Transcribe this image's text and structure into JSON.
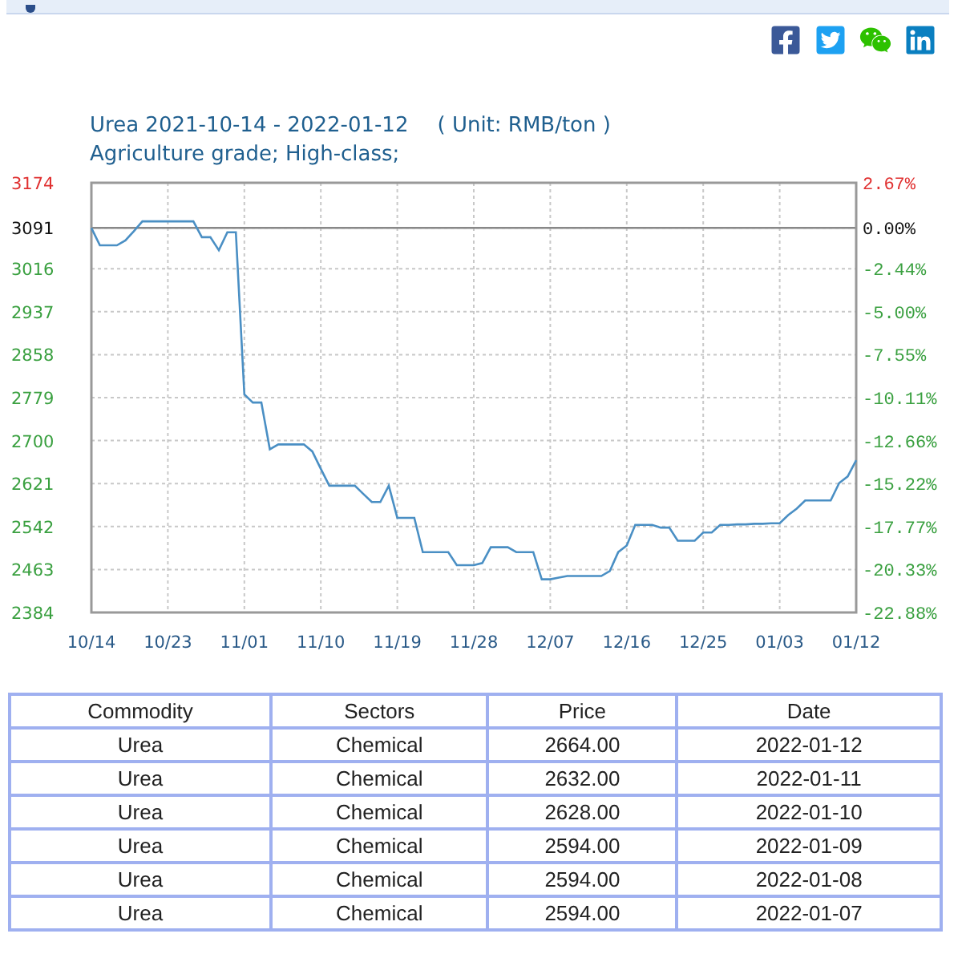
{
  "chart": {
    "title": "Urea 2021-10-14 - 2022-01-12",
    "unit": "( Unit: RMB/ton )",
    "subtitle": "Agriculture grade; High-class;",
    "right_axis_labels": [
      "2.67%",
      "0.00%",
      "-2.44%",
      "-5.00%",
      "-7.55%",
      "-10.11%",
      "-12.66%",
      "-15.22%",
      "-17.77%",
      "-20.33%",
      "-22.88%"
    ],
    "chart_data": {
      "type": "line",
      "categories": [
        "10/14",
        null,
        null,
        null,
        null,
        null,
        null,
        null,
        null,
        "10/23",
        null,
        null,
        null,
        null,
        null,
        null,
        null,
        null,
        "11/01",
        null,
        null,
        null,
        null,
        null,
        null,
        null,
        null,
        "11/10",
        null,
        null,
        null,
        null,
        null,
        null,
        null,
        null,
        "11/19",
        null,
        null,
        null,
        null,
        null,
        null,
        null,
        null,
        "11/28",
        null,
        null,
        null,
        null,
        null,
        null,
        null,
        null,
        "12/07",
        null,
        null,
        null,
        null,
        null,
        null,
        null,
        null,
        "12/16",
        null,
        null,
        null,
        null,
        null,
        null,
        null,
        null,
        "12/25",
        null,
        null,
        null,
        null,
        null,
        null,
        null,
        null,
        "01/03",
        null,
        null,
        null,
        null,
        null,
        null,
        null,
        null,
        "01/12"
      ],
      "series": [
        {
          "color": "#4a8fc4",
          "values": [
            3091,
            3059,
            3059,
            3059,
            3068,
            3085,
            3103,
            3103,
            3103,
            3103,
            3103,
            3103,
            3103,
            3074,
            3074,
            3050,
            3083,
            3083,
            2785,
            2770,
            2770,
            2684,
            2693,
            2693,
            2693,
            2693,
            2680,
            2648,
            2617,
            2617,
            2617,
            2617,
            2602,
            2587,
            2587,
            2617,
            2558,
            2558,
            2558,
            2495,
            2495,
            2495,
            2495,
            2471,
            2471,
            2471,
            2475,
            2504,
            2504,
            2504,
            2495,
            2495,
            2495,
            2445,
            2445,
            2448,
            2451,
            2451,
            2451,
            2451,
            2451,
            2460,
            2495,
            2507,
            2545,
            2545,
            2545,
            2540,
            2540,
            2516,
            2516,
            2516,
            2531,
            2531,
            2545,
            2545,
            2546,
            2546,
            2547,
            2547,
            2548,
            2548,
            2563,
            2575,
            2590,
            2590,
            2590,
            2590,
            2622,
            2634,
            2664
          ]
        }
      ],
      "ylim": [
        2384,
        3174
      ],
      "grid": true,
      "yticks": [
        3174,
        3091,
        3016,
        2937,
        2858,
        2779,
        2700,
        2621,
        2542,
        2463,
        2384
      ],
      "ref_lines": [
        {
          "axis": "y",
          "value": 3091
        }
      ]
    }
  },
  "table": {
    "columns": [
      "Commodity",
      "Sectors",
      "Price",
      "Date"
    ],
    "rows": [
      [
        "Urea",
        "Chemical",
        "2664.00",
        "2022-01-12"
      ],
      [
        "Urea",
        "Chemical",
        "2632.00",
        "2022-01-11"
      ],
      [
        "Urea",
        "Chemical",
        "2628.00",
        "2022-01-10"
      ],
      [
        "Urea",
        "Chemical",
        "2594.00",
        "2022-01-09"
      ],
      [
        "Urea",
        "Chemical",
        "2594.00",
        "2022-01-08"
      ],
      [
        "Urea",
        "Chemical",
        "2594.00",
        "2022-01-07"
      ]
    ]
  }
}
